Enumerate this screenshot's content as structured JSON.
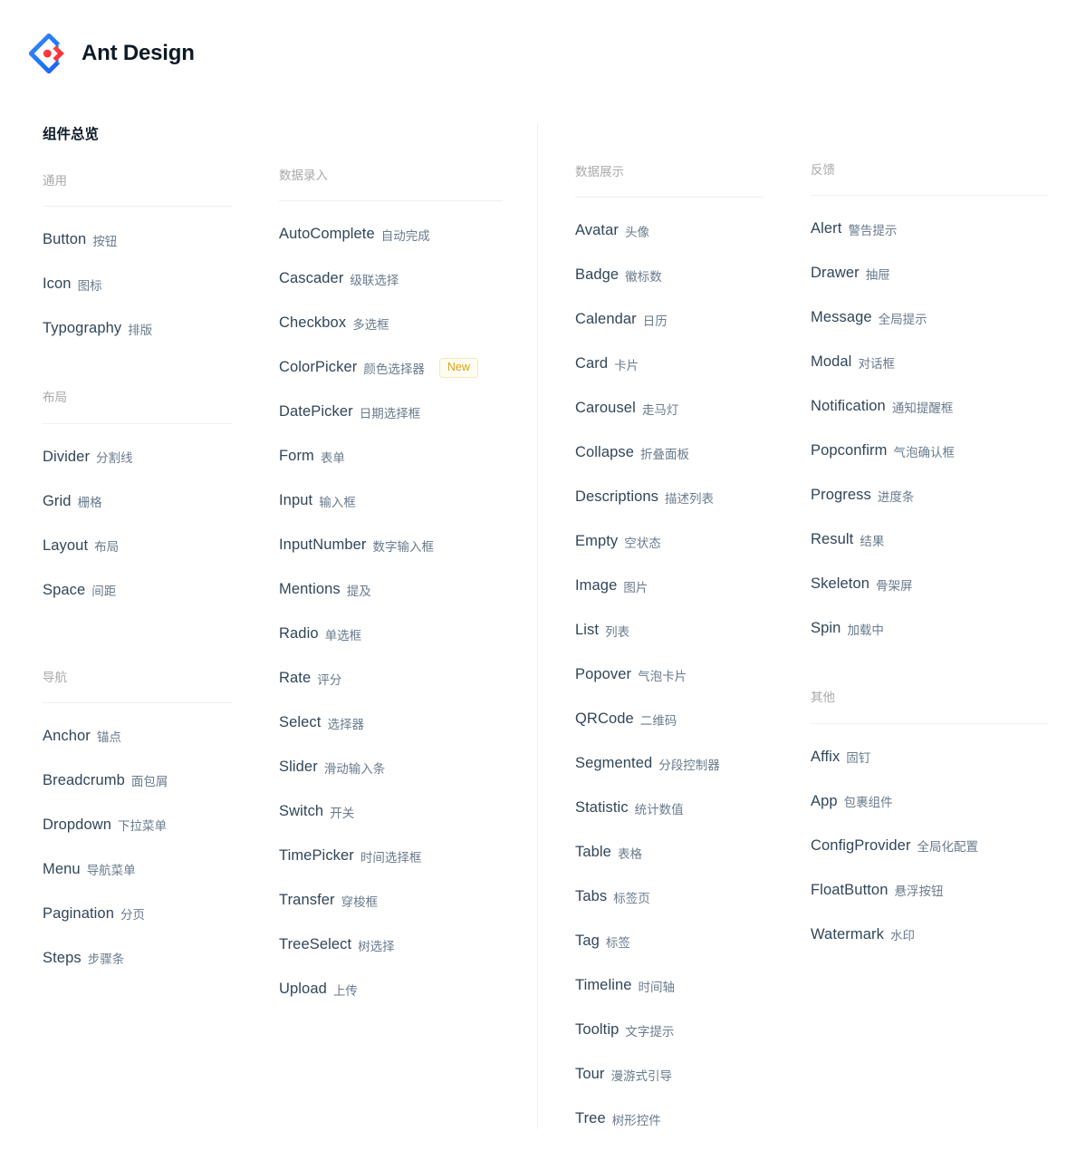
{
  "brand": {
    "name": "Ant Design",
    "logo_icon": "ant-design-logo-icon"
  },
  "page": {
    "title": "组件总览"
  },
  "colors": {
    "logo_blue": "#1677ff",
    "logo_red": "#f5222d",
    "text_primary": "#0d1a26",
    "text_item": "#314659",
    "text_cn": "#697b8c",
    "text_group": "#a9a9a9",
    "divider": "#f0f0f0",
    "badge_text": "#d9a014",
    "badge_bg": "#fffdf2",
    "badge_border": "#f7e8b6"
  },
  "columns": [
    {
      "groups": [
        {
          "title": "通用",
          "items": [
            {
              "en": "Button",
              "cn": "按钮"
            },
            {
              "en": "Icon",
              "cn": "图标"
            },
            {
              "en": "Typography",
              "cn": "排版"
            }
          ]
        },
        {
          "title": "布局",
          "items": [
            {
              "en": "Divider",
              "cn": "分割线"
            },
            {
              "en": "Grid",
              "cn": "栅格"
            },
            {
              "en": "Layout",
              "cn": "布局"
            },
            {
              "en": "Space",
              "cn": "间距"
            }
          ]
        },
        {
          "title": "导航",
          "items": [
            {
              "en": "Anchor",
              "cn": "锚点"
            },
            {
              "en": "Breadcrumb",
              "cn": "面包屑"
            },
            {
              "en": "Dropdown",
              "cn": "下拉菜单"
            },
            {
              "en": "Menu",
              "cn": "导航菜单"
            },
            {
              "en": "Pagination",
              "cn": "分页"
            },
            {
              "en": "Steps",
              "cn": "步骤条"
            }
          ]
        }
      ]
    },
    {
      "groups": [
        {
          "title": "数据录入",
          "items": [
            {
              "en": "AutoComplete",
              "cn": "自动完成"
            },
            {
              "en": "Cascader",
              "cn": "级联选择"
            },
            {
              "en": "Checkbox",
              "cn": "多选框"
            },
            {
              "en": "ColorPicker",
              "cn": "颜色选择器",
              "badge": "New"
            },
            {
              "en": "DatePicker",
              "cn": "日期选择框"
            },
            {
              "en": "Form",
              "cn": "表单"
            },
            {
              "en": "Input",
              "cn": "输入框"
            },
            {
              "en": "InputNumber",
              "cn": "数字输入框"
            },
            {
              "en": "Mentions",
              "cn": "提及"
            },
            {
              "en": "Radio",
              "cn": "单选框"
            },
            {
              "en": "Rate",
              "cn": "评分"
            },
            {
              "en": "Select",
              "cn": "选择器"
            },
            {
              "en": "Slider",
              "cn": "滑动输入条"
            },
            {
              "en": "Switch",
              "cn": "开关"
            },
            {
              "en": "TimePicker",
              "cn": "时间选择框"
            },
            {
              "en": "Transfer",
              "cn": "穿梭框"
            },
            {
              "en": "TreeSelect",
              "cn": "树选择"
            },
            {
              "en": "Upload",
              "cn": "上传"
            }
          ]
        }
      ]
    },
    {
      "groups": [
        {
          "title": "数据展示",
          "items": [
            {
              "en": "Avatar",
              "cn": "头像"
            },
            {
              "en": "Badge",
              "cn": "徽标数"
            },
            {
              "en": "Calendar",
              "cn": "日历"
            },
            {
              "en": "Card",
              "cn": "卡片"
            },
            {
              "en": "Carousel",
              "cn": "走马灯"
            },
            {
              "en": "Collapse",
              "cn": "折叠面板"
            },
            {
              "en": "Descriptions",
              "cn": "描述列表"
            },
            {
              "en": "Empty",
              "cn": "空状态"
            },
            {
              "en": "Image",
              "cn": "图片"
            },
            {
              "en": "List",
              "cn": "列表"
            },
            {
              "en": "Popover",
              "cn": "气泡卡片"
            },
            {
              "en": "QRCode",
              "cn": "二维码"
            },
            {
              "en": "Segmented",
              "cn": "分段控制器"
            },
            {
              "en": "Statistic",
              "cn": "统计数值"
            },
            {
              "en": "Table",
              "cn": "表格"
            },
            {
              "en": "Tabs",
              "cn": "标签页"
            },
            {
              "en": "Tag",
              "cn": "标签"
            },
            {
              "en": "Timeline",
              "cn": "时间轴"
            },
            {
              "en": "Tooltip",
              "cn": "文字提示"
            },
            {
              "en": "Tour",
              "cn": "漫游式引导"
            },
            {
              "en": "Tree",
              "cn": "树形控件"
            }
          ]
        }
      ]
    },
    {
      "groups": [
        {
          "title": "反馈",
          "items": [
            {
              "en": "Alert",
              "cn": "警告提示"
            },
            {
              "en": "Drawer",
              "cn": "抽屉"
            },
            {
              "en": "Message",
              "cn": "全局提示"
            },
            {
              "en": "Modal",
              "cn": "对话框"
            },
            {
              "en": "Notification",
              "cn": "通知提醒框"
            },
            {
              "en": "Popconfirm",
              "cn": "气泡确认框"
            },
            {
              "en": "Progress",
              "cn": "进度条"
            },
            {
              "en": "Result",
              "cn": "结果"
            },
            {
              "en": "Skeleton",
              "cn": "骨架屏"
            },
            {
              "en": "Spin",
              "cn": "加载中"
            }
          ]
        },
        {
          "title": "其他",
          "items": [
            {
              "en": "Affix",
              "cn": "固钉"
            },
            {
              "en": "App",
              "cn": "包裹组件"
            },
            {
              "en": "ConfigProvider",
              "cn": "全局化配置"
            },
            {
              "en": "FloatButton",
              "cn": "悬浮按钮"
            },
            {
              "en": "Watermark",
              "cn": "水印"
            }
          ]
        }
      ]
    }
  ]
}
